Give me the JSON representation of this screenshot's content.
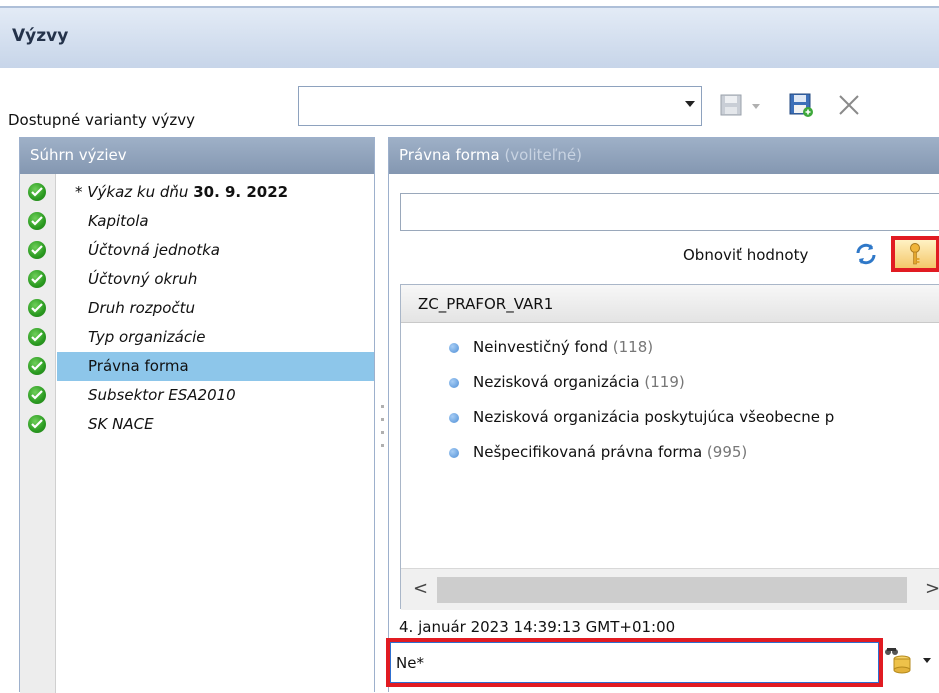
{
  "window": {
    "title": "Výzvy"
  },
  "variants": {
    "label": "Dostupné varianty výzvy",
    "selected_value": ""
  },
  "summary": {
    "title": "Súhrn výziev",
    "root_prefix": "* Výkaz ku dňu ",
    "root_date": "30. 9. 2022",
    "items": [
      "Kapitola",
      "Účtovná jednotka",
      "Účtovný okruh",
      "Druh rozpočtu",
      "Typ organizácie",
      "Právna forma",
      "Subsektor ESA2010",
      "SK NACE"
    ],
    "selected": "Právna forma"
  },
  "detail": {
    "title": "Právna forma",
    "optional": "(voliteľné)",
    "filter_value": "",
    "refresh_label": "Obnoviť hodnoty",
    "list_header": "ZC_PRAFOR_VAR1",
    "values": [
      {
        "text": "Neinvestičný fond",
        "count": "(118)"
      },
      {
        "text": "Nezisková organizácia",
        "count": "(119)"
      },
      {
        "text": "Nezisková organizácia poskytujúca všeobecne p",
        "count": ""
      },
      {
        "text": "Nešpecifikovaná právna forma",
        "count": "(995)"
      }
    ],
    "timestamp": "4. január 2023 14:39:13 GMT+01:00",
    "search_value": "Ne*"
  },
  "colors": {
    "highlight_box": "#e11b22",
    "selection": "#8dc6ea",
    "header": "#8fa2bb",
    "check": "#2a9a20"
  }
}
